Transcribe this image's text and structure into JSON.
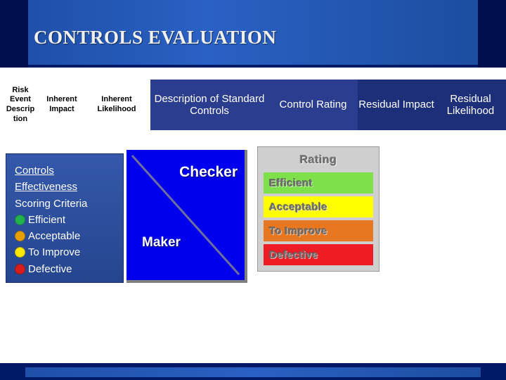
{
  "slide": {
    "title": "CONTROLS EVALUATION"
  },
  "header": {
    "columns": [
      {
        "label": "Risk Event Descrip tion",
        "style": "white"
      },
      {
        "label": "Inherent Impact",
        "style": "white"
      },
      {
        "label": "Inherent Likelihood",
        "style": "white"
      },
      {
        "label": "Description of Standard Controls",
        "style": "blue"
      },
      {
        "label": "Control Rating",
        "style": "blue"
      },
      {
        "label": "Residual Impact",
        "style": "navy"
      },
      {
        "label": "Residual Likelihood",
        "style": "navy"
      }
    ],
    "col_texts": {
      "risk_event": "Risk Event Descrip tion",
      "inherent_impact": "Inherent Impact",
      "inherent_likelihood": "Inherent Likelihood",
      "description_controls": "Description of Standard Controls",
      "control_rating": "Control Rating",
      "residual_impact": "Residual Impact",
      "residual_likelihood": "Residual Likelihood"
    }
  },
  "scoring": {
    "heading_line1": "Controls",
    "heading_line2": "Effectiveness",
    "heading_line3": "Scoring Criteria",
    "items": [
      {
        "label": "Efficient",
        "color": "#22b14c"
      },
      {
        "label": "Acceptable",
        "color": "#e8a000"
      },
      {
        "label": "To Improve",
        "color": "#ffe800"
      },
      {
        "label": "Defective",
        "color": "#d81b1b"
      }
    ]
  },
  "maker_checker": {
    "checker": "Checker",
    "maker": "Maker"
  },
  "rating_legend": {
    "title": "Rating",
    "items": [
      {
        "label": "Efficient",
        "color": "#7ee04a"
      },
      {
        "label": "Acceptable",
        "color": "#ffff00"
      },
      {
        "label": "To Improve",
        "color": "#e87722"
      },
      {
        "label": "Defective",
        "color": "#ee1c25"
      }
    ]
  },
  "colors": {
    "slide_navy": "#001a66",
    "band_blue": "#2a61c4",
    "header_blue": "#2b3d8f",
    "header_navy": "#1e2f7a",
    "score_box": "#2f4f9f",
    "maker_checker_box": "#0000ee"
  }
}
